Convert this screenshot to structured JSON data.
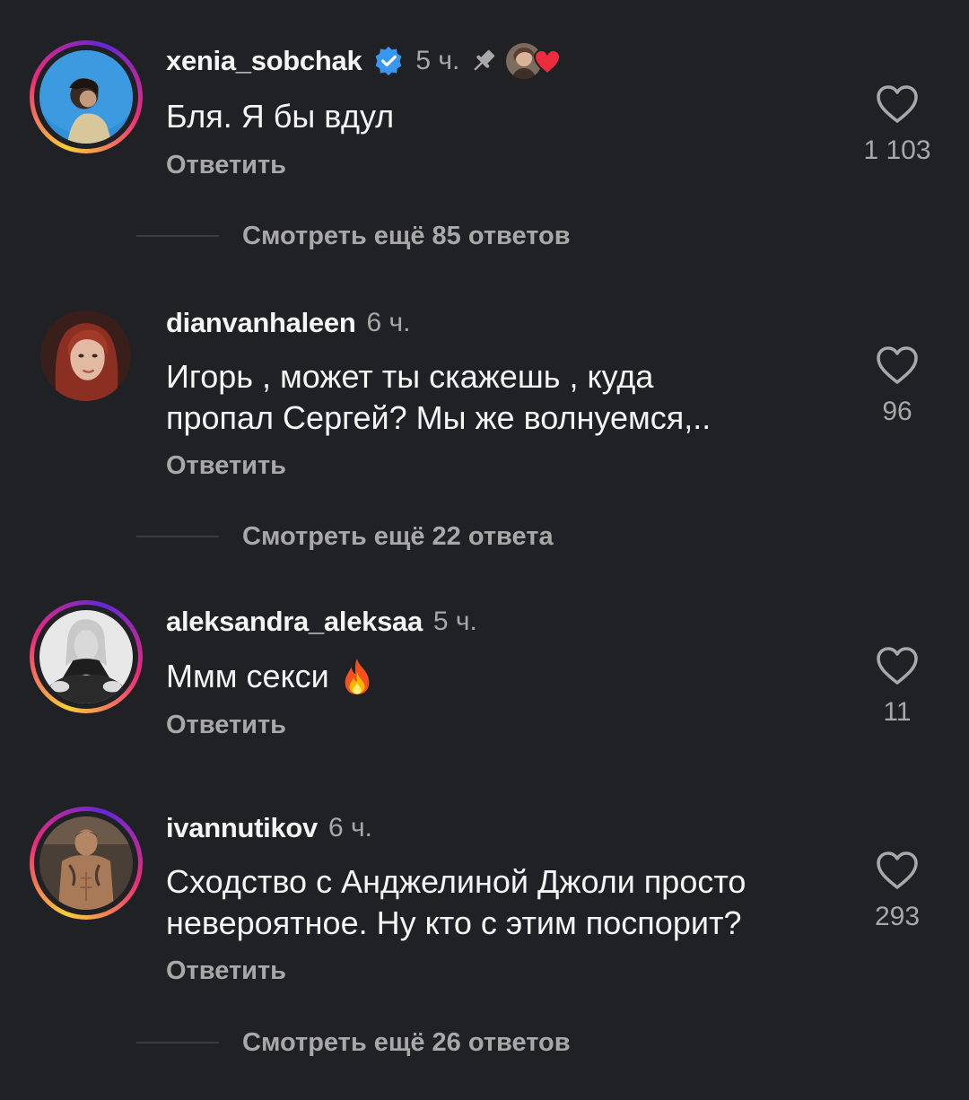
{
  "comments": [
    {
      "username": "xenia_sobchak",
      "verified": true,
      "time": "5 ч.",
      "pinned": true,
      "liked_by_author": true,
      "text": "Бля. Я бы вдул",
      "reply_label": "Ответить",
      "likes": "1 103",
      "more_replies": "Смотреть ещё 85 ответов"
    },
    {
      "username": "dianvanhaleen",
      "time": "6 ч.",
      "text_lines": [
        "Игорь , может ты скажешь , куда",
        "пропал Сергей? Мы же волнуемся,.."
      ],
      "reply_label": "Ответить",
      "likes": "96",
      "more_replies": "Смотреть ещё 22 ответа"
    },
    {
      "username": "aleksandra_aleksaa",
      "time": "5 ч.",
      "text": "Ммм секси",
      "emoji": "fire",
      "reply_label": "Ответить",
      "likes": "11"
    },
    {
      "username": "ivannutikov",
      "time": "6 ч.",
      "text_lines": [
        "Сходство с Анджелиной Джоли просто",
        "невероятное. Ну кто с этим поспорит?"
      ],
      "reply_label": "Ответить",
      "likes": "293",
      "more_replies": "Смотреть ещё 26 ответов"
    }
  ],
  "colors": {
    "background": "#202124",
    "text_primary": "#f5f5f5",
    "text_secondary": "#a8a8a8",
    "verified": "#3897f0",
    "liked_heart": "#ed2d3d"
  },
  "icons": [
    "verified-badge-icon",
    "pin-icon",
    "heart-icon",
    "fire-emoji-icon"
  ]
}
